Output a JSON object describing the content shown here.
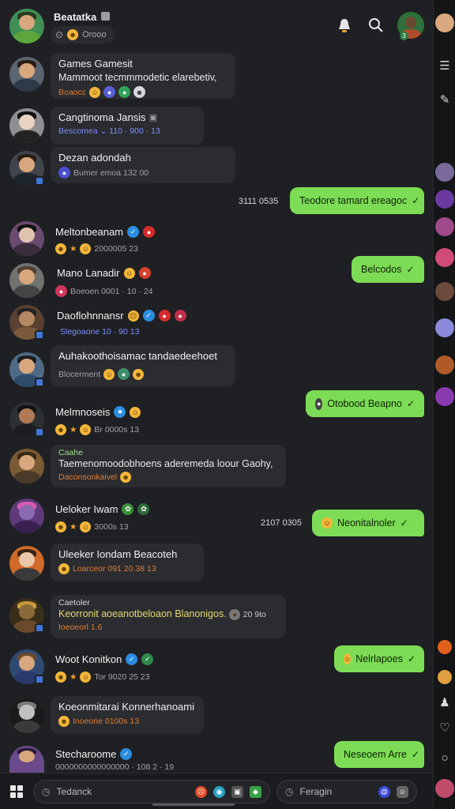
{
  "header": {
    "title": "Beatatka",
    "subtitle": "Orooo",
    "avatar_colors": [
      "#4aa86a",
      "#d9a77e"
    ],
    "right_avatar_badge": "3"
  },
  "messages": [
    {
      "type": "in",
      "name": "Games Gamesit",
      "text": "Mammoot tecmmmodetic elarebetiv,",
      "meta": "Boaocc",
      "meta_class": "orange"
    },
    {
      "type": "in",
      "name": "Cangtinoma Jansis",
      "text": "",
      "meta": "Bescomea  ⌄ 110 · 900 ·  13",
      "meta_class": "blue"
    },
    {
      "type": "in",
      "name": "Dezan adondah",
      "text": "",
      "meta": "Bumer emoa 132 00",
      "meta_class": ""
    },
    {
      "type": "out",
      "text": "Teodore tamard ereagoc",
      "time": "3111 0535"
    },
    {
      "type": "plain",
      "name": "Meltonbeanam",
      "meta": "2000005  23"
    },
    {
      "type": "out",
      "text": "Belcodos",
      "time": ""
    },
    {
      "type": "plain",
      "name": "Mano Lanadir",
      "meta": "Boeoen 0001 · 10 · 24"
    },
    {
      "type": "plain",
      "name": "Daoflohnnansr",
      "meta": "Slegoaone  10 · 90   13",
      "meta_class": "blue"
    },
    {
      "type": "in",
      "name": "Auhakoothoisamac tandaedeehoet",
      "text": "",
      "meta": "Blocerment",
      "meta_class": ""
    },
    {
      "type": "out",
      "text": "Otobood Beapno",
      "time": ""
    },
    {
      "type": "plain",
      "name": "Melmnoseis",
      "meta": "Br 0000s  13"
    },
    {
      "type": "in",
      "name": "Caahe",
      "text": "Taemenomoodobhoens aderemeda loour Gaohy,",
      "meta": "Daconsonkaivel",
      "meta_class": "orange",
      "small_label": true
    },
    {
      "type": "plain",
      "name": "Ueloker Iwam",
      "meta": "3000s  13"
    },
    {
      "type": "out",
      "text": "Neonitalnoler",
      "time": "2107 0305"
    },
    {
      "type": "in",
      "name": "Uleeker Iondam Beacoteh",
      "text": "",
      "meta": "Loarceor  091 20.38   13",
      "meta_class": "orange"
    },
    {
      "type": "in",
      "name": "Caetoler",
      "text": "Keorronit aoeanotbeloaon Blanonigos.",
      "meta": "Ioeoeorl   1.6",
      "meta_class": "orange",
      "small_label": true,
      "trailing": "20 9to"
    },
    {
      "type": "plain",
      "name": "Woot Konitkon",
      "meta": "Tor 9020 25 23"
    },
    {
      "type": "out",
      "text": "Nelrlapoes",
      "time": ""
    },
    {
      "type": "in",
      "name": "Koeonmitarai Konnerhanoami",
      "text": "",
      "meta": "Inoeone  0100s   13",
      "meta_class": "orange"
    },
    {
      "type": "out",
      "text": "Neseoem Arre",
      "time": ""
    },
    {
      "type": "plain",
      "name": "Stecharoome",
      "meta": "0000000000000000 · 108 2 · 19"
    }
  ],
  "bottom": {
    "left_input_placeholder": "Tedanck",
    "right_input_placeholder": "Feragin"
  },
  "accent": "#7ddc55"
}
